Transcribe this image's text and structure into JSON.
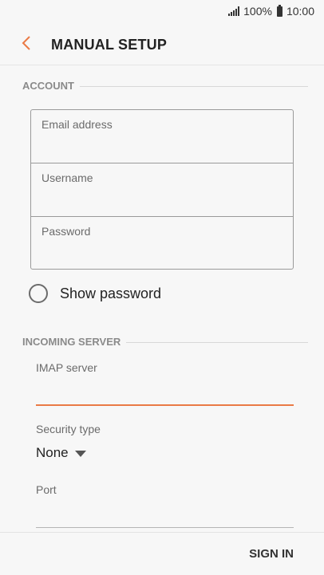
{
  "status_bar": {
    "battery": "100%",
    "time": "10:00"
  },
  "app_bar": {
    "title": "MANUAL SETUP",
    "back_icon": "chevron-left-icon",
    "accent_color": "#ea7a45"
  },
  "account": {
    "header": "ACCOUNT",
    "fields": [
      {
        "label": "Email address",
        "value": ""
      },
      {
        "label": "Username",
        "value": ""
      },
      {
        "label": "Password",
        "value": ""
      }
    ],
    "show_password_label": "Show password",
    "show_password_checked": false
  },
  "incoming_server": {
    "header": "INCOMING SERVER",
    "imap_server_label": "IMAP server",
    "imap_server_value": "",
    "security_type_label": "Security type",
    "security_type_value": "None",
    "port_label": "Port",
    "port_value": ""
  },
  "footer": {
    "sign_in_label": "SIGN IN"
  }
}
